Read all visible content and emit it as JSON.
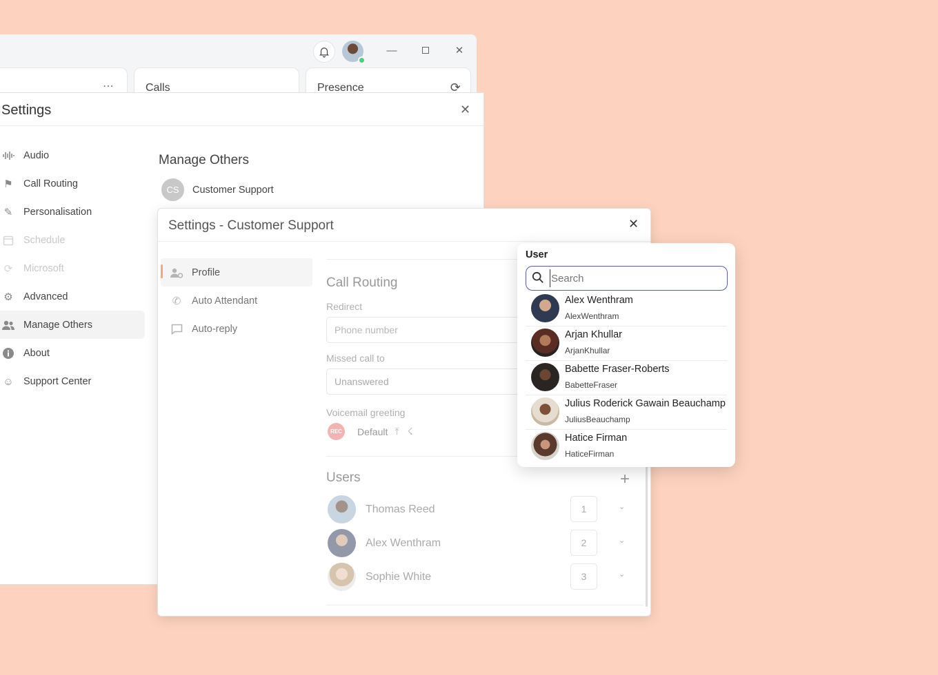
{
  "app": {
    "cards": [
      {
        "title": ""
      },
      {
        "title": "Calls"
      },
      {
        "title": "Presence"
      }
    ]
  },
  "settings": {
    "title": "Settings",
    "nav": [
      {
        "label": "Audio",
        "icon": "waveform-icon",
        "state": "normal"
      },
      {
        "label": "Call Routing",
        "icon": "signpost-icon",
        "state": "normal"
      },
      {
        "label": "Personalisation",
        "icon": "brush-icon",
        "state": "normal"
      },
      {
        "label": "Schedule",
        "icon": "calendar-icon",
        "state": "disabled"
      },
      {
        "label": "Microsoft",
        "icon": "sync-icon",
        "state": "disabled"
      },
      {
        "label": "Advanced",
        "icon": "gears-icon",
        "state": "normal"
      },
      {
        "label": "Manage Others",
        "icon": "people-icon",
        "state": "active"
      },
      {
        "label": "About",
        "icon": "info-icon",
        "state": "normal"
      },
      {
        "label": "Support Center",
        "icon": "support-icon",
        "state": "normal"
      }
    ],
    "manage_others": {
      "title": "Manage Others",
      "entry": {
        "initials": "CS",
        "label": "Customer Support"
      }
    }
  },
  "dialog": {
    "title": "Settings - Customer Support",
    "subnav": [
      {
        "label": "Profile",
        "icon": "user-gear-icon",
        "active": true
      },
      {
        "label": "Auto Attendant",
        "icon": "phone-forward-icon",
        "active": false
      },
      {
        "label": "Auto-reply",
        "icon": "message-icon",
        "active": false
      }
    ],
    "call_routing": {
      "title": "Call Routing",
      "redirect_label": "Redirect",
      "redirect_placeholder": "Phone number",
      "missed_label": "Missed call to",
      "missed_value": "Unanswered",
      "voicemail_label": "Voicemail greeting",
      "rec_badge": "REC",
      "voicemail_value": "Default"
    },
    "users": {
      "title": "Users",
      "add_symbol": "+",
      "list": [
        {
          "name": "Thomas Reed",
          "order": "1"
        },
        {
          "name": "Alex Wenthram",
          "order": "2"
        },
        {
          "name": "Sophie White",
          "order": "3"
        }
      ]
    }
  },
  "picker": {
    "title": "User",
    "search_placeholder": "Search",
    "results": [
      {
        "name": "Alex Wenthram",
        "username": "AlexWenthram"
      },
      {
        "name": "Arjan Khullar",
        "username": "ArjanKhullar"
      },
      {
        "name": "Babette Fraser-Roberts",
        "username": "BabetteFraser"
      },
      {
        "name": "Julius Roderick Gawain Beauchamp",
        "username": "JuliusBeauchamp"
      },
      {
        "name": "Hatice Firman",
        "username": "HaticeFirman"
      }
    ]
  },
  "colors": {
    "background": "#fdd3c0",
    "accent": "#f7a57b",
    "search_border": "#5160b5",
    "status_online": "#4cd07d"
  }
}
